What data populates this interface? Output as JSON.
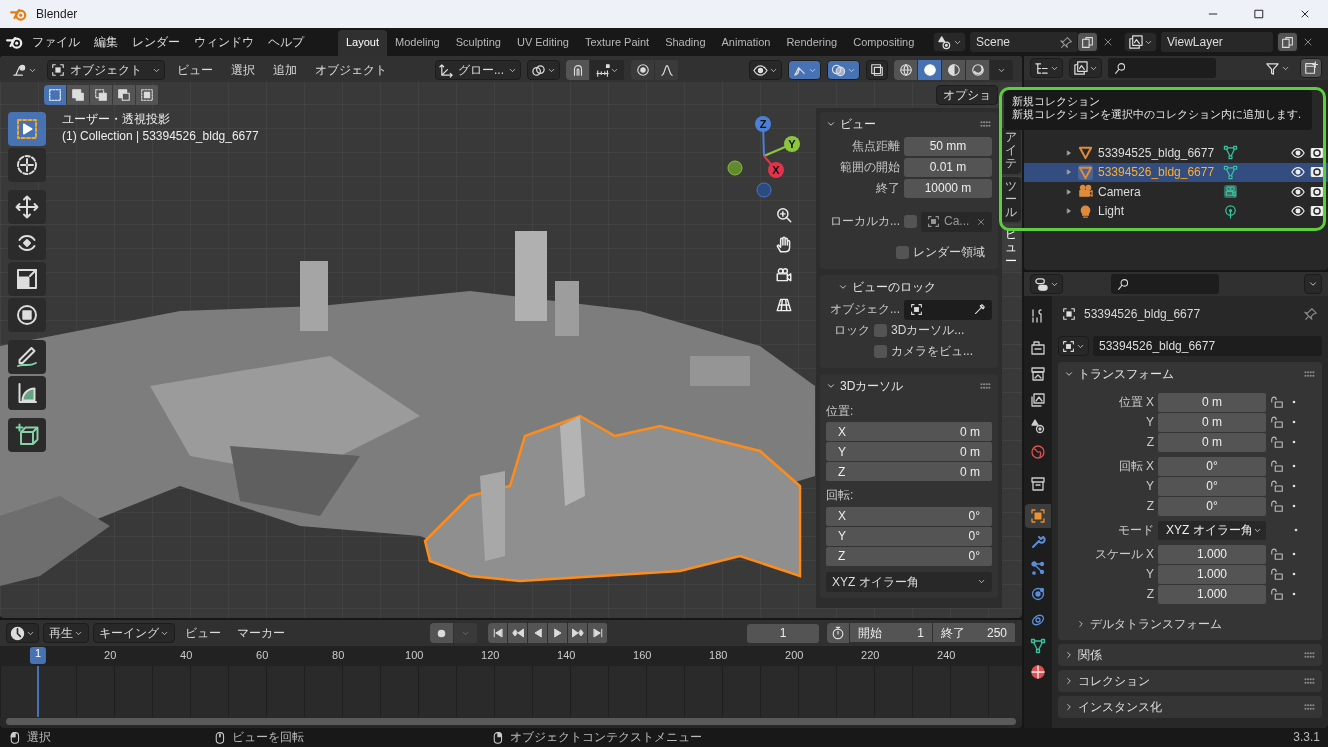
{
  "window": {
    "title": "Blender"
  },
  "menus": [
    "ファイル",
    "編集",
    "レンダー",
    "ウィンドウ",
    "ヘルプ"
  ],
  "workspaces": [
    {
      "label": "Layout",
      "selected": true
    },
    {
      "label": "Modeling",
      "selected": false
    },
    {
      "label": "Sculpting",
      "selected": false
    },
    {
      "label": "UV Editing",
      "selected": false
    },
    {
      "label": "Texture Paint",
      "selected": false
    },
    {
      "label": "Shading",
      "selected": false
    },
    {
      "label": "Animation",
      "selected": false
    },
    {
      "label": "Rendering",
      "selected": false
    },
    {
      "label": "Compositing",
      "selected": false
    }
  ],
  "scene": {
    "value": "Scene"
  },
  "view_layer": {
    "value": "ViewLayer"
  },
  "viewport": {
    "mode": "オブジェクト",
    "menus": [
      "ビュー",
      "選択",
      "追加",
      "オブジェクト"
    ],
    "orientation": "グロー...",
    "options": "オプショ",
    "select_modes": [
      {
        "selected": true
      },
      {
        "selected": false
      },
      {
        "selected": false
      },
      {
        "selected": false
      },
      {
        "selected": false
      }
    ],
    "shading_modes": [
      {
        "selected": false
      },
      {
        "selected": true
      },
      {
        "selected": false
      },
      {
        "selected": false
      }
    ],
    "tools": [
      {
        "kind": "select",
        "selected": true
      },
      {
        "kind": "cursor",
        "selected": false
      },
      {
        "kind": "move",
        "selected": false
      },
      {
        "kind": "rotate",
        "selected": false
      },
      {
        "kind": "scale",
        "selected": false
      },
      {
        "kind": "transform",
        "selected": false
      },
      {
        "kind": "annotate",
        "selected": false
      },
      {
        "kind": "measure",
        "selected": false
      },
      {
        "kind": "add_cube",
        "selected": false
      }
    ],
    "view_title": "ユーザー・透視投影",
    "view_info": "(1) Collection | 53394526_bldg_6677",
    "gizmo_axes": [
      "X",
      "Y",
      "Z"
    ]
  },
  "sidebar": {
    "tabs": [
      {
        "label": "アイテ",
        "selected": false
      },
      {
        "label": "ツール",
        "selected": false
      },
      {
        "label": "ビュー",
        "selected": true
      }
    ],
    "view": {
      "title": "ビュー",
      "fields": [
        {
          "label": "焦点距離",
          "value": "50 mm"
        },
        {
          "label": "範囲の開始",
          "value": "0.01 m"
        },
        {
          "label": "終了",
          "value": "10000 m"
        }
      ],
      "local_camera": {
        "label": "ローカルカ...",
        "checked": false,
        "value": "Ca..."
      },
      "render_region": {
        "label": "レンダー領域",
        "checked": false
      }
    },
    "view_lock": {
      "title": "ビューのロック",
      "object_label": "オブジェク...",
      "lock_label": "ロック",
      "options": [
        {
          "label": "3Dカーソル...",
          "checked": false
        },
        {
          "label": "カメラをビュ...",
          "checked": false
        }
      ]
    },
    "cursor": {
      "title": "3Dカーソル",
      "location_label": "位置:",
      "location": [
        {
          "axis": "X",
          "value": "0 m"
        },
        {
          "axis": "Y",
          "value": "0 m"
        },
        {
          "axis": "Z",
          "value": "0 m"
        }
      ],
      "rotation_label": "回転:",
      "rotation": [
        {
          "axis": "X",
          "value": "0°"
        },
        {
          "axis": "Y",
          "value": "0°"
        },
        {
          "axis": "Z",
          "value": "0°"
        }
      ],
      "mode": "XYZ オイラー角"
    }
  },
  "tooltip": {
    "title": "新規コレクション",
    "text": "新規コレクションを選択中のコレクション内に追加します."
  },
  "outliner": {
    "rows": [
      {
        "name": "53394525_bldg_6677",
        "kind": "mesh",
        "selected": false
      },
      {
        "name": "53394526_bldg_6677",
        "kind": "mesh",
        "selected": true
      },
      {
        "name": "Camera",
        "kind": "camera",
        "selected": false
      },
      {
        "name": "Light",
        "kind": "light",
        "selected": false
      }
    ]
  },
  "properties": {
    "tabs": [
      {
        "kind": "tool",
        "selected": false
      },
      {
        "kind": "render",
        "selected": false
      },
      {
        "kind": "output",
        "selected": false
      },
      {
        "kind": "view_layer",
        "selected": false
      },
      {
        "kind": "scene",
        "selected": false
      },
      {
        "kind": "world",
        "selected": false
      },
      {
        "kind": "collection",
        "selected": false
      },
      {
        "kind": "object",
        "selected": true
      },
      {
        "kind": "modifiers",
        "selected": false
      },
      {
        "kind": "particles",
        "selected": false
      },
      {
        "kind": "physics",
        "selected": false
      },
      {
        "kind": "constraints",
        "selected": false
      },
      {
        "kind": "data",
        "selected": false
      },
      {
        "kind": "material",
        "selected": false
      }
    ],
    "object_name": "53394526_bldg_6677",
    "datablock": "53394526_bldg_6677",
    "transform": {
      "title": "トランスフォーム",
      "groups": [
        {
          "rows": [
            {
              "kind": "field",
              "label": "位置 X",
              "value": "0 m"
            },
            {
              "kind": "field",
              "label": "Y",
              "value": "0 m"
            },
            {
              "kind": "field",
              "label": "Z",
              "value": "0 m"
            }
          ]
        },
        {
          "rows": [
            {
              "kind": "field",
              "label": "回転 X",
              "value": "0°"
            },
            {
              "kind": "field",
              "label": "Y",
              "value": "0°"
            },
            {
              "kind": "field",
              "label": "Z",
              "value": "0°"
            }
          ]
        },
        {
          "rows": [
            {
              "kind": "dropdown",
              "label": "モード",
              "value": "XYZ オイラー角"
            }
          ]
        },
        {
          "rows": [
            {
              "kind": "field",
              "label": "スケール X",
              "value": "1.000"
            },
            {
              "kind": "field",
              "label": "Y",
              "value": "1.000"
            },
            {
              "kind": "field",
              "label": "Z",
              "value": "1.000"
            }
          ]
        }
      ],
      "subsection": "デルタトランスフォーム"
    },
    "panels": [
      "関係",
      "コレクション",
      "インスタンス化"
    ]
  },
  "timeline": {
    "menus": [
      "再生",
      "キーイング",
      "ビュー",
      "マーカー"
    ],
    "current_frame": "1",
    "start_label": "開始",
    "start": "1",
    "end_label": "終了",
    "end": "250",
    "ticks": [
      "1",
      "20",
      "40",
      "60",
      "80",
      "100",
      "120",
      "140",
      "160",
      "180",
      "200",
      "220",
      "240"
    ]
  },
  "status_bar": {
    "items": [
      "選択",
      "ビューを回転",
      "オブジェクトコンテクストメニュー"
    ],
    "version": "3.3.1"
  }
}
